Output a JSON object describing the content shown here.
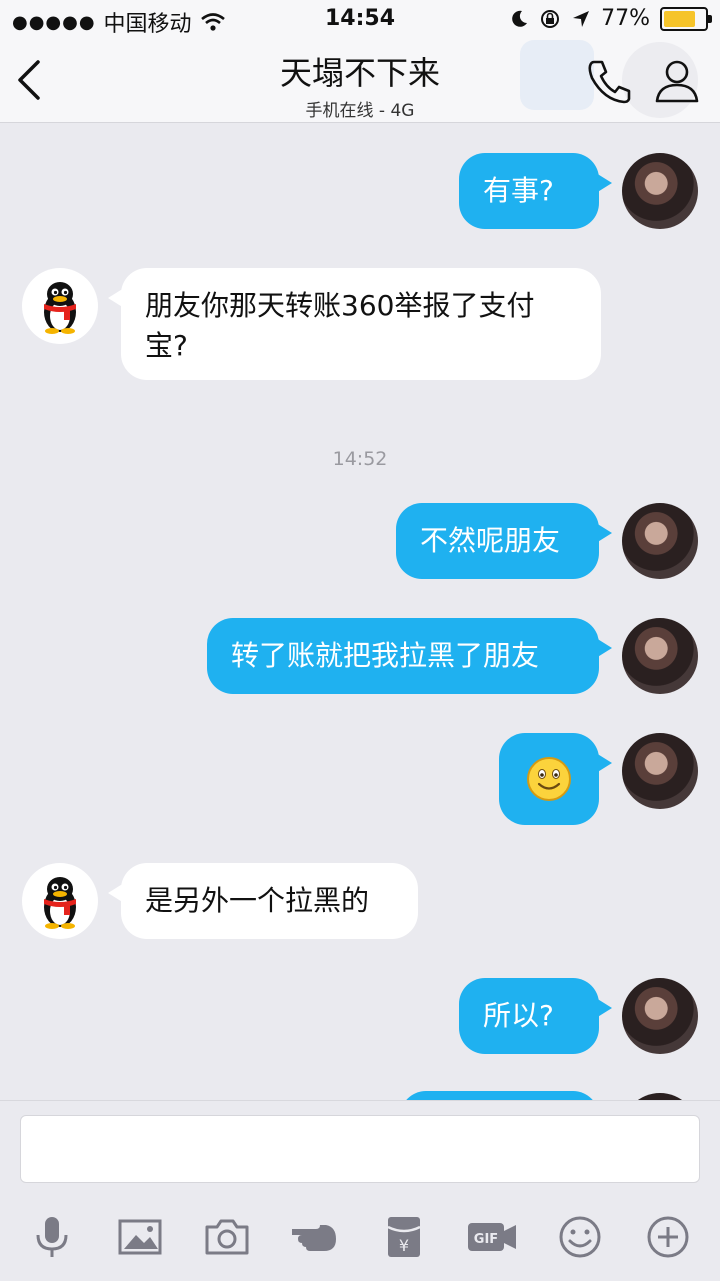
{
  "status_bar": {
    "carrier": "中国移动",
    "signal_dots": "●●●●●",
    "time": "14:54",
    "battery_percent": "77%",
    "battery_level": 0.77
  },
  "header": {
    "title": "天塌不下来",
    "subtitle": "手机在线 - 4G"
  },
  "messages": [
    {
      "side": "out",
      "text": "有事?"
    },
    {
      "side": "in",
      "text": "朋友你那天转账360举报了支付宝?"
    },
    {
      "side": "time",
      "text": "14:52"
    },
    {
      "side": "out",
      "text": "不然呢朋友"
    },
    {
      "side": "out",
      "text": "转了账就把我拉黑了朋友"
    },
    {
      "side": "out",
      "emoji": "smile"
    },
    {
      "side": "in",
      "text": "是另外一个拉黑的"
    },
    {
      "side": "out",
      "text": "所以?"
    }
  ],
  "input": {
    "placeholder": ""
  },
  "toolbar": [
    "microphone-icon",
    "image-icon",
    "camera-icon",
    "poke-icon",
    "red-packet-icon",
    "gif-icon",
    "emoji-icon",
    "plus-icon"
  ],
  "colors": {
    "outgoing_bubble": "#1fb1f0",
    "incoming_bubble": "#ffffff",
    "background": "#eaeaef"
  }
}
